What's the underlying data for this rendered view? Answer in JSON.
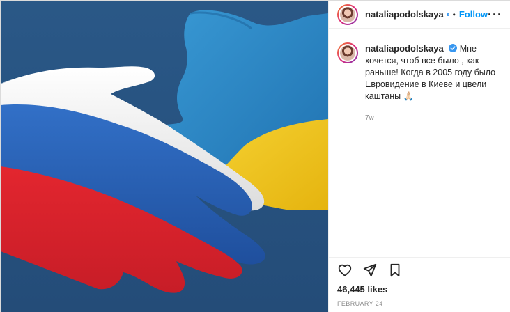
{
  "post": {
    "username": "nataliapodolskaya",
    "follow_label": "Follow",
    "more_icon": "more-options-icon",
    "caption_username": "nataliapodolskaya",
    "caption_text": "Мне хочется, чтоб все было , как раньше! Когда в 2005 году было Евровидение в Киеве и цвели каштаны 🙏🏻",
    "age": "7w",
    "likes": "46,445 likes",
    "date": "FEBRUARY 24",
    "image_description_colors": {
      "background": "#2b5a8a",
      "russian_flag": [
        "#f4f4f4",
        "#2b63b7",
        "#d6252c"
      ],
      "ukrainian_flag": [
        "#2f87c7",
        "#f2c91f"
      ]
    },
    "icons": {
      "verified": "verified-badge-icon",
      "like": "heart-icon",
      "share": "send-icon",
      "save": "bookmark-icon"
    }
  }
}
